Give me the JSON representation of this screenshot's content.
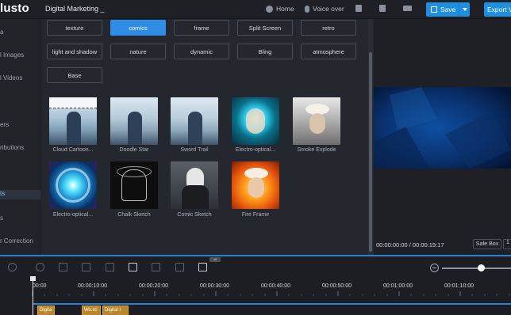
{
  "header": {
    "logo": "lusto",
    "project_title": "Digital Marketing _",
    "home_label": "Home",
    "voice_over_label": "Voice over",
    "save_label": "Save",
    "export_label": "Export V"
  },
  "sidebar": {
    "items": [
      {
        "label": "a",
        "active": false
      },
      {
        "label": "l Images",
        "active": false
      },
      {
        "label": "l Videos",
        "active": false
      },
      {
        "label": "ers",
        "active": false
      },
      {
        "label": "ributions",
        "active": false
      },
      {
        "label": "ts",
        "active": true
      },
      {
        "label": "s",
        "active": false
      },
      {
        "label": "r Correction",
        "active": false
      }
    ]
  },
  "effects": {
    "tags": [
      {
        "label": "texture",
        "active": false
      },
      {
        "label": "comics",
        "active": true
      },
      {
        "label": "frame",
        "active": false
      },
      {
        "label": "Split Screen",
        "active": false
      },
      {
        "label": "retro",
        "active": false
      },
      {
        "label": "light and shadow",
        "active": false
      },
      {
        "label": "nature",
        "active": false
      },
      {
        "label": "dynamic",
        "active": false
      },
      {
        "label": "Bling",
        "active": false
      },
      {
        "label": "atmosphere",
        "active": false
      },
      {
        "label": "Base",
        "active": false
      }
    ],
    "items": [
      {
        "label": "Cloud Cartoon..."
      },
      {
        "label": "Doodle Star"
      },
      {
        "label": "Sword Trail"
      },
      {
        "label": "Electro-optical..."
      },
      {
        "label": "Smoke Explode"
      },
      {
        "label": "Electro-optical..."
      },
      {
        "label": "Chalk Sketch"
      },
      {
        "label": "Comic Sketch"
      },
      {
        "label": "Fire Frame"
      }
    ]
  },
  "preview": {
    "current_time": "00:00:00:00",
    "separator": "/",
    "total_time": "00:00:19:17",
    "safe_box_label": "Safe Box",
    "ratio_label": "1"
  },
  "timeline": {
    "badge": "off",
    "tick_labels": [
      "00:00",
      "00:00:10:00",
      "00:00:20:00",
      "00:00:30:00",
      "00:00:40:00",
      "00:00:50:00",
      "00:01:00:00",
      "00:01:10:00"
    ],
    "clips": [
      {
        "label": "Digita"
      },
      {
        "label": "Wo.rd"
      },
      {
        "label": "Digital I"
      }
    ]
  }
}
